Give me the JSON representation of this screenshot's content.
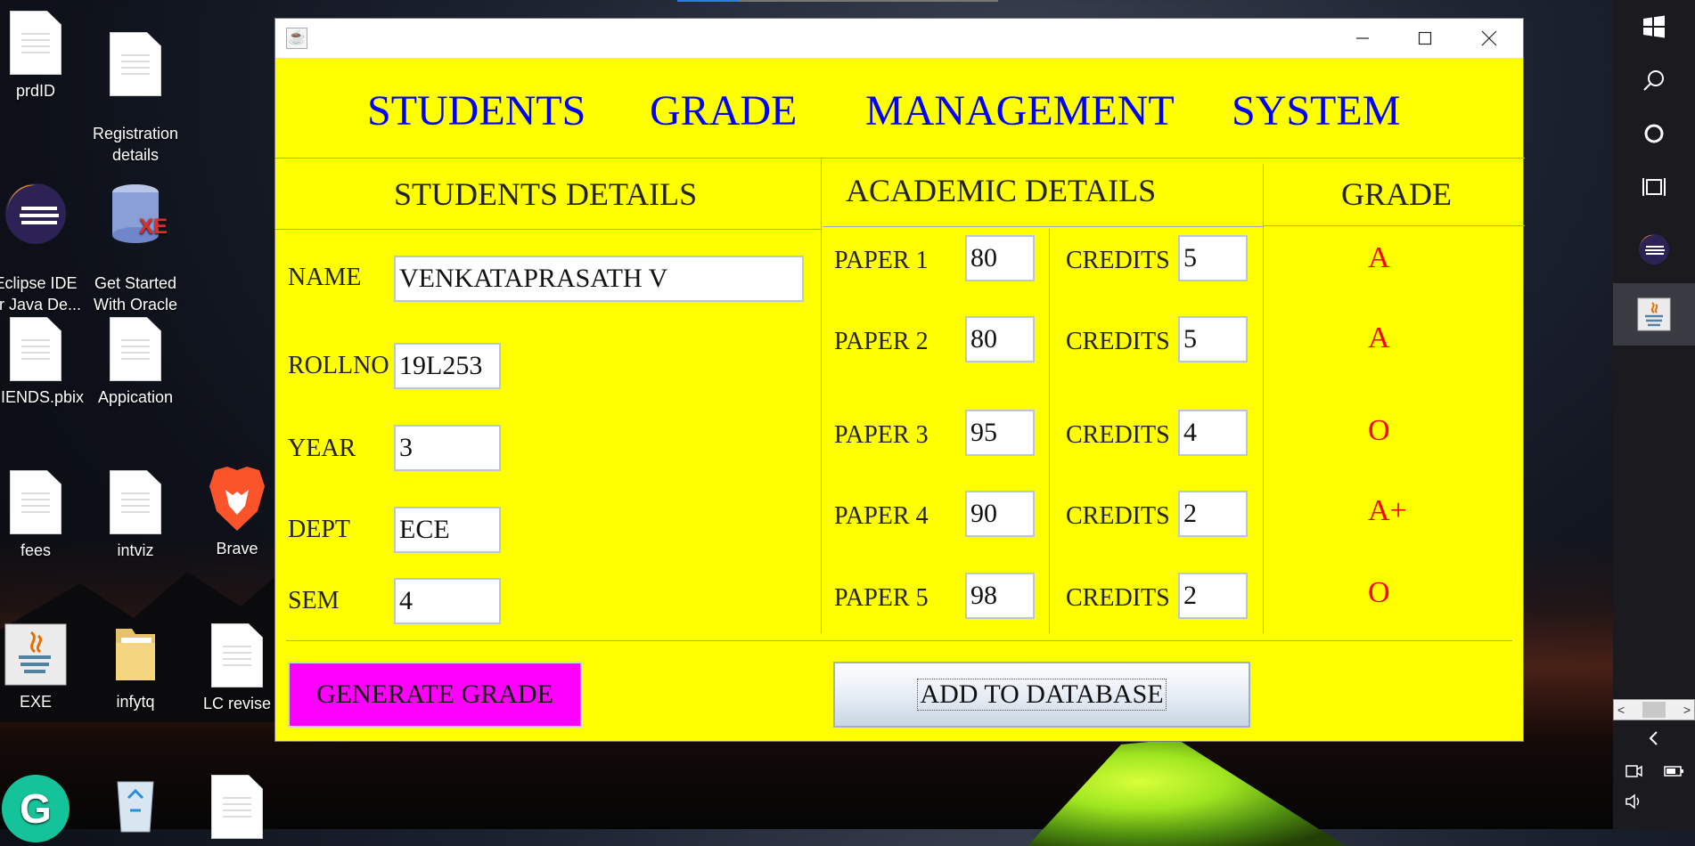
{
  "desktop": {
    "icons": [
      {
        "label": "prdID",
        "type": "doc"
      },
      {
        "label": "Registration\ndetails",
        "type": "doc"
      },
      {
        "label": "Eclipse IDE\nor Java De...",
        "type": "eclipse"
      },
      {
        "label": "Get Started\nWith Oracle ...",
        "type": "oracle"
      },
      {
        "label": "RIENDS.pbix",
        "type": "doc"
      },
      {
        "label": "Appication",
        "type": "doc"
      },
      {
        "label": "fees",
        "type": "doc"
      },
      {
        "label": "intviz",
        "type": "doc"
      },
      {
        "label": "Brave",
        "type": "brave"
      },
      {
        "label": "EXE",
        "type": "java"
      },
      {
        "label": "infytq",
        "type": "folder"
      },
      {
        "label": "LC revise",
        "type": "doc"
      }
    ]
  },
  "sidebar": {
    "buttons": [
      "windows-logo-icon",
      "search-icon",
      "cortana-icon",
      "task-view-icon",
      "eclipse-icon",
      "java-icon"
    ],
    "tray": [
      "chevron-left-icon",
      "meet-now-icon",
      "battery-icon",
      "volume-icon"
    ]
  },
  "window": {
    "header": [
      "STUDENTS",
      "GRADE",
      "MANAGEMENT",
      "SYSTEM"
    ],
    "sections": {
      "students": "STUDENTS DETAILS",
      "academic": "ACADEMIC DETAILS",
      "grade": "GRADE"
    },
    "student": {
      "name_label": "NAME",
      "name_value": "VENKATAPRASATH V",
      "roll_label": "ROLLNO",
      "roll_value": "19L253",
      "year_label": "YEAR",
      "year_value": "3",
      "dept_label": "DEPT",
      "dept_value": "ECE",
      "sem_label": "SEM",
      "sem_value": "4"
    },
    "papers": [
      {
        "label": "PAPER 1",
        "mark": "80",
        "credits_label": "CREDITS",
        "credits": "5",
        "grade": "A"
      },
      {
        "label": "PAPER 2",
        "mark": "80",
        "credits_label": "CREDITS",
        "credits": "5",
        "grade": "A"
      },
      {
        "label": "PAPER 3",
        "mark": "95",
        "credits_label": "CREDITS",
        "credits": "4",
        "grade": "O"
      },
      {
        "label": "PAPER 4",
        "mark": "90",
        "credits_label": "CREDITS",
        "credits": "2",
        "grade": "A+"
      },
      {
        "label": "PAPER 5",
        "mark": "98",
        "credits_label": "CREDITS",
        "credits": "2",
        "grade": "O"
      }
    ],
    "buttons": {
      "generate": "GENERATE GRADE",
      "add": "ADD TO DATABASE"
    }
  },
  "colors": {
    "window_bg": "#ffff00",
    "header_text": "#0000ff",
    "grade_text": "#ff0000",
    "generate_bg": "#ff00ff"
  }
}
